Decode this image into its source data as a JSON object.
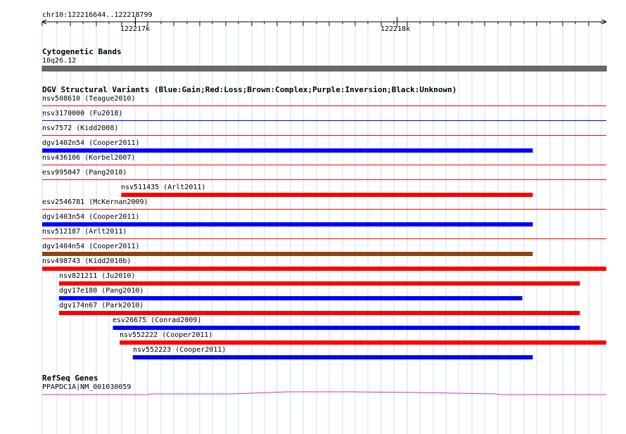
{
  "ruler": {
    "location": "chr10:122216644..122218799",
    "ticks": [
      {
        "label": "122217k",
        "pos": 122217000
      },
      {
        "label": "122218k",
        "pos": 122218000
      }
    ]
  },
  "cytoband": {
    "title": "Cytogenetic Bands",
    "band": "10q26.12"
  },
  "dgv": {
    "title": "DGV Structural Variants (Blue:Gain;Red:Loss;Brown:Complex;Purple:Inversion;Black:Unknown)",
    "colors": {
      "gain": "#0000ff",
      "loss": "#ff0000",
      "complex": "#8b4513",
      "inversion": "#800080",
      "unknown": "#000000"
    },
    "variants": [
      {
        "label": "nsv508610 (Teague2010)",
        "type": "loss",
        "start": 122216644,
        "end": 122218799,
        "thin": true
      },
      {
        "label": "nsv3170000 (Fu2018)",
        "type": "gain",
        "start": 122216644,
        "end": 122218799,
        "thin": true
      },
      {
        "label": "nsv7572 (Kidd2008)",
        "type": "loss",
        "start": 122216644,
        "end": 122218799,
        "thin": true
      },
      {
        "label": "dgv1402n54 (Cooper2011)",
        "type": "gain",
        "start": 122216644,
        "end": 122218518,
        "thin": false
      },
      {
        "label": "nsv436106 (Korbel2007)",
        "type": "loss",
        "start": 122216644,
        "end": 122218799,
        "thin": true
      },
      {
        "label": "esv995047 (Pang2010)",
        "type": "loss",
        "start": 122216644,
        "end": 122218799,
        "thin": true
      },
      {
        "label": "nsv511435 (Arlt2011)",
        "type": "loss",
        "start": 122216946,
        "end": 122218518,
        "thin": false
      },
      {
        "label": "esv2546781 (McKernan2009)",
        "type": "loss",
        "start": 122216644,
        "end": 122218799,
        "thin": true
      },
      {
        "label": "dgv1403n54 (Cooper2011)",
        "type": "gain",
        "start": 122216644,
        "end": 122218518,
        "thin": false
      },
      {
        "label": "nsv512187 (Arlt2011)",
        "type": "loss",
        "start": 122216644,
        "end": 122218799,
        "thin": true
      },
      {
        "label": "dgv1404n54 (Cooper2011)",
        "type": "complex",
        "start": 122216644,
        "end": 122218518,
        "thin": false
      },
      {
        "label": "nsv498743 (Kidd2010b)",
        "type": "loss",
        "start": 122216644,
        "end": 122218799,
        "thin": false
      },
      {
        "label": "nsv821211 (Ju2010)",
        "type": "loss",
        "start": 122216708,
        "end": 122218698,
        "thin": false
      },
      {
        "label": "dgv17e180 (Pang2010)",
        "type": "gain",
        "start": 122216708,
        "end": 122218478,
        "thin": false
      },
      {
        "label": "dgv174n67 (Park2010)",
        "type": "loss",
        "start": 122216708,
        "end": 122218698,
        "thin": false
      },
      {
        "label": "esv26675 (Conrad2009)",
        "type": "gain",
        "start": 122216914,
        "end": 122218698,
        "thin": false
      },
      {
        "label": "nsv552222 (Cooper2011)",
        "type": "loss",
        "start": 122216940,
        "end": 122218799,
        "thin": false
      },
      {
        "label": "nsv552223 (Cooper2011)",
        "type": "gain",
        "start": 122216990,
        "end": 122218518,
        "thin": false
      }
    ]
  },
  "refseq": {
    "title": "RefSeq Genes",
    "gene": "PPAPDC1A|NM_001030059",
    "color": "#cc33cc"
  }
}
